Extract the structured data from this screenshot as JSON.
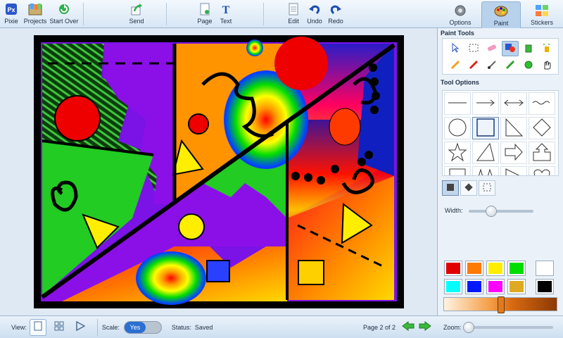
{
  "toolbar": {
    "pixie": "Pixie",
    "projects": "Projects",
    "start_over": "Start Over",
    "send": "Send",
    "page": "Page",
    "text": "Text",
    "edit": "Edit",
    "undo": "Undo",
    "redo": "Redo"
  },
  "panel_tabs": {
    "options": "Options",
    "paint": "Paint",
    "stickers": "Stickers"
  },
  "paint_tools": {
    "title": "Paint Tools"
  },
  "tool_options": {
    "title": "Tool Options",
    "width_label": "Width:",
    "width_value": 0.35
  },
  "bottom": {
    "view_label": "View:",
    "scale_label": "Scale:",
    "scale_value": "Yes",
    "status_label": "Status:",
    "status_value": "Saved",
    "page_indicator": "Page 2 of 2"
  },
  "zoom": {
    "label": "Zoom:",
    "value": 0.0
  },
  "colors": {
    "palette": [
      "#e00000",
      "#ff7a00",
      "#ffee00",
      "#00dd00",
      "#00ffff",
      "#0018ff",
      "#ff00ff",
      "#ddaa22"
    ],
    "white": "#ffffff",
    "black": "#000000",
    "accent": "#2a6fd1",
    "selected_brush": "#e07a20"
  },
  "icons": {
    "toolbar": [
      "pixie-logo-icon",
      "projects-icon",
      "start-over-icon",
      "send-icon",
      "page-icon",
      "text-icon",
      "edit-icon",
      "undo-icon",
      "redo-icon"
    ],
    "tools": [
      "select-arrow-icon",
      "marquee-icon",
      "eraser-icon",
      "shape-tool-icon",
      "fill-bucket-icon",
      "spray-icon",
      "pencil-icon",
      "marker-icon",
      "brush-icon",
      "dropper-icon",
      "blob-icon",
      "smudge-icon"
    ]
  }
}
